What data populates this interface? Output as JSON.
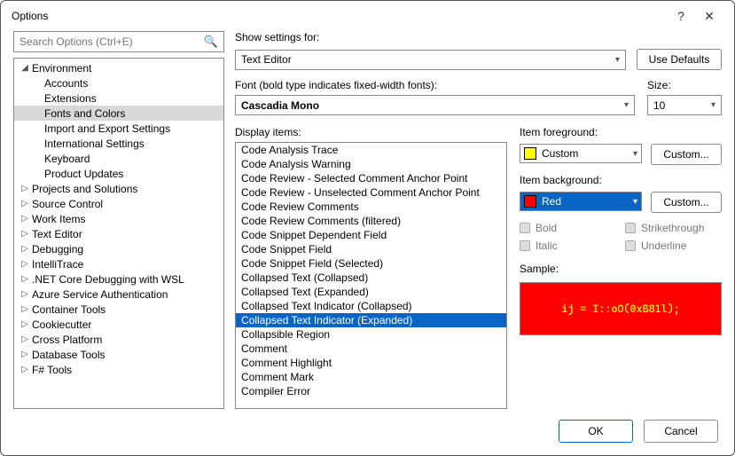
{
  "window": {
    "title": "Options",
    "help": "?",
    "close": "✕"
  },
  "search": {
    "placeholder": "Search Options (Ctrl+E)"
  },
  "tree": {
    "env_label": "Environment",
    "env_expanded": true,
    "children": [
      "Accounts",
      "Extensions",
      "Fonts and Colors",
      "Import and Export Settings",
      "International Settings",
      "Keyboard",
      "Product Updates"
    ],
    "selected_child": "Fonts and Colors",
    "siblings": [
      "Projects and Solutions",
      "Source Control",
      "Work Items",
      "Text Editor",
      "Debugging",
      "IntelliTrace",
      ".NET Core Debugging with WSL",
      "Azure Service Authentication",
      "Container Tools",
      "Cookiecutter",
      "Cross Platform",
      "Database Tools",
      "F# Tools"
    ]
  },
  "settings": {
    "show_label": "Show settings for:",
    "show_value": "Text Editor",
    "use_defaults": "Use Defaults",
    "font_label": "Font (bold type indicates fixed-width fonts):",
    "font_value": "Cascadia Mono",
    "size_label": "Size:",
    "size_value": "10",
    "display_items_label": "Display items:",
    "display_items": [
      "Code Analysis Trace",
      "Code Analysis Warning",
      "Code Review - Selected Comment Anchor Point",
      "Code Review - Unselected Comment Anchor Point",
      "Code Review Comments",
      "Code Review Comments (filtered)",
      "Code Snippet Dependent Field",
      "Code Snippet Field",
      "Code Snippet Field (Selected)",
      "Collapsed Text (Collapsed)",
      "Collapsed Text (Expanded)",
      "Collapsed Text Indicator (Collapsed)",
      "Collapsed Text Indicator (Expanded)",
      "Collapsible Region",
      "Comment",
      "Comment Highlight",
      "Comment Mark",
      "Compiler Error"
    ],
    "selected_display_item": "Collapsed Text Indicator (Expanded)",
    "item_fg_label": "Item foreground:",
    "item_fg_value": "Custom",
    "item_fg_swatch": "#ffff00",
    "item_bg_label": "Item background:",
    "item_bg_value": "Red",
    "item_bg_swatch": "#ff0000",
    "custom_btn": "Custom...",
    "bold": "Bold",
    "italic": "Italic",
    "strike": "Strikethrough",
    "underline": "Underline",
    "sample_label": "Sample:",
    "sample_text": "ij = I::oO(0xB81l);"
  },
  "footer": {
    "ok": "OK",
    "cancel": "Cancel"
  }
}
